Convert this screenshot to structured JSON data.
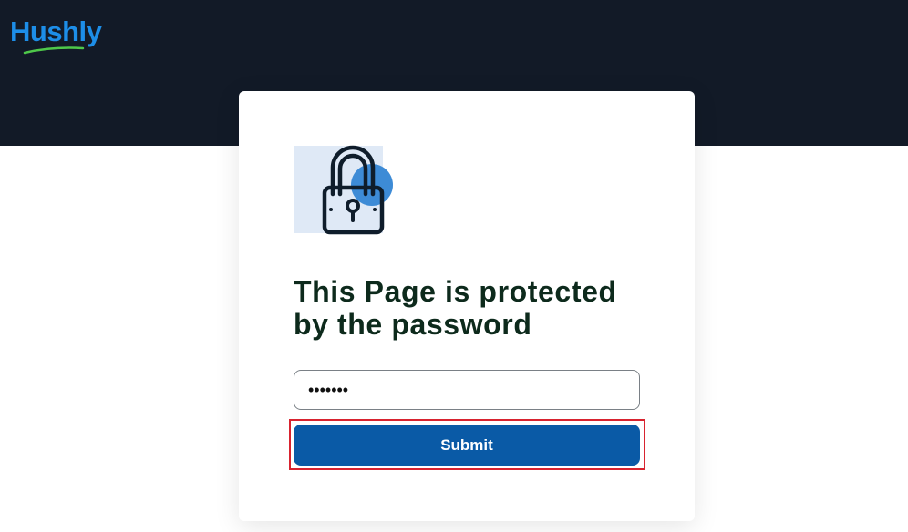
{
  "brand": {
    "name": "Hushly",
    "logo_color": "#1d8ee8",
    "swoosh_color": "#4ec84a"
  },
  "colors": {
    "header_background": "#121a27",
    "button_background": "#0a5aa6",
    "heading_color": "#0d2a1c",
    "highlight_border": "#d8232f"
  },
  "card": {
    "icon": "lock-icon",
    "heading": "This Page is protected by the password",
    "password": {
      "value": "•••••••"
    },
    "submit_label": "Submit"
  }
}
